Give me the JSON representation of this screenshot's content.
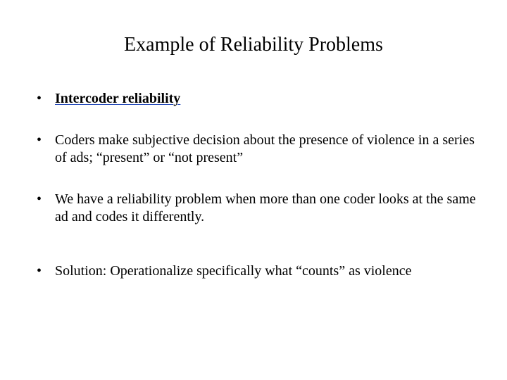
{
  "slide": {
    "title": "Example of Reliability Problems",
    "bullets": [
      {
        "text": "Intercoder reliability",
        "link": true
      },
      {
        "text": "Coders make subjective decision about the presence of violence in a series of ads; “present” or  “not present”",
        "link": false
      },
      {
        "text": "We have a reliability problem when more than one coder looks at the same ad and codes it differently.",
        "link": false
      },
      {
        "text": "Solution:  Operationalize specifically what “counts” as violence",
        "link": false
      }
    ]
  }
}
